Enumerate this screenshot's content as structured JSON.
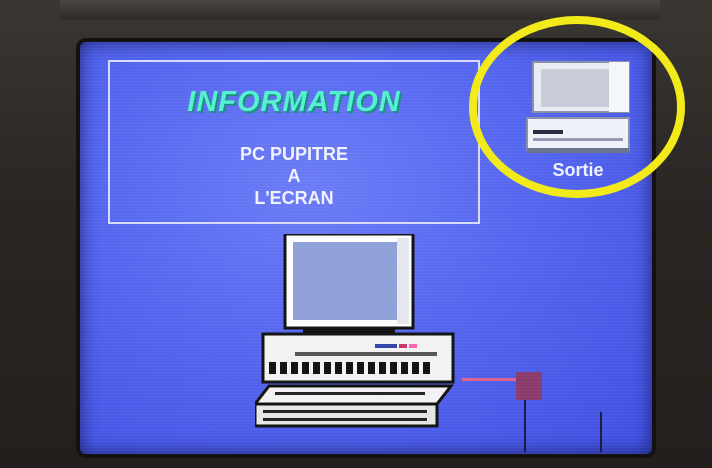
{
  "panel": {
    "title": "INFORMATION",
    "line1": "PC PUPITRE",
    "line2": "A",
    "line3": "L'ECRAN"
  },
  "exit_button": {
    "label": "Sortie",
    "icon": "computer-icon"
  },
  "illustration": {
    "icon": "desktop-computer-icon"
  },
  "colors": {
    "screen_bg": "#5566ef",
    "title_color": "#55f0d0",
    "text_color": "#f0f2ff",
    "highlight": "#f3ea1c"
  }
}
